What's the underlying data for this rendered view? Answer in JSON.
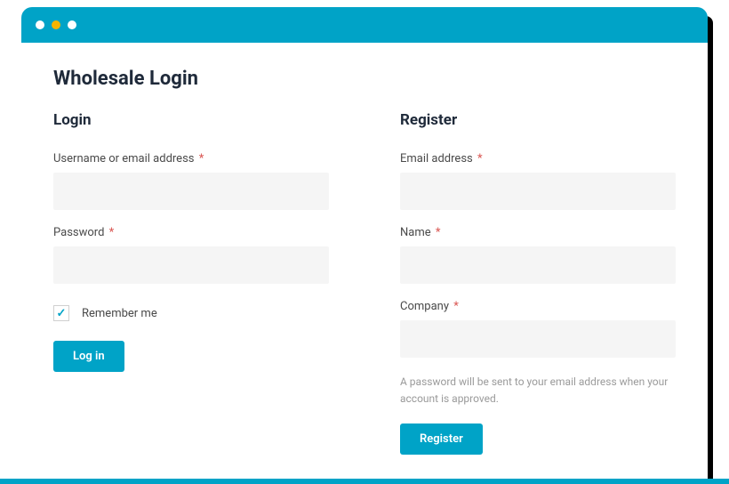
{
  "page": {
    "title": "Wholesale Login"
  },
  "login": {
    "section_title": "Login",
    "username_label": "Username or email address",
    "password_label": "Password",
    "remember_label": "Remember me",
    "submit_label": "Log in",
    "required_mark": "*"
  },
  "register": {
    "section_title": "Register",
    "email_label": "Email address",
    "name_label": "Name",
    "company_label": "Company",
    "helper_text": "A password will be sent to your email address when your account is approved.",
    "submit_label": "Register",
    "required_mark": "*"
  }
}
